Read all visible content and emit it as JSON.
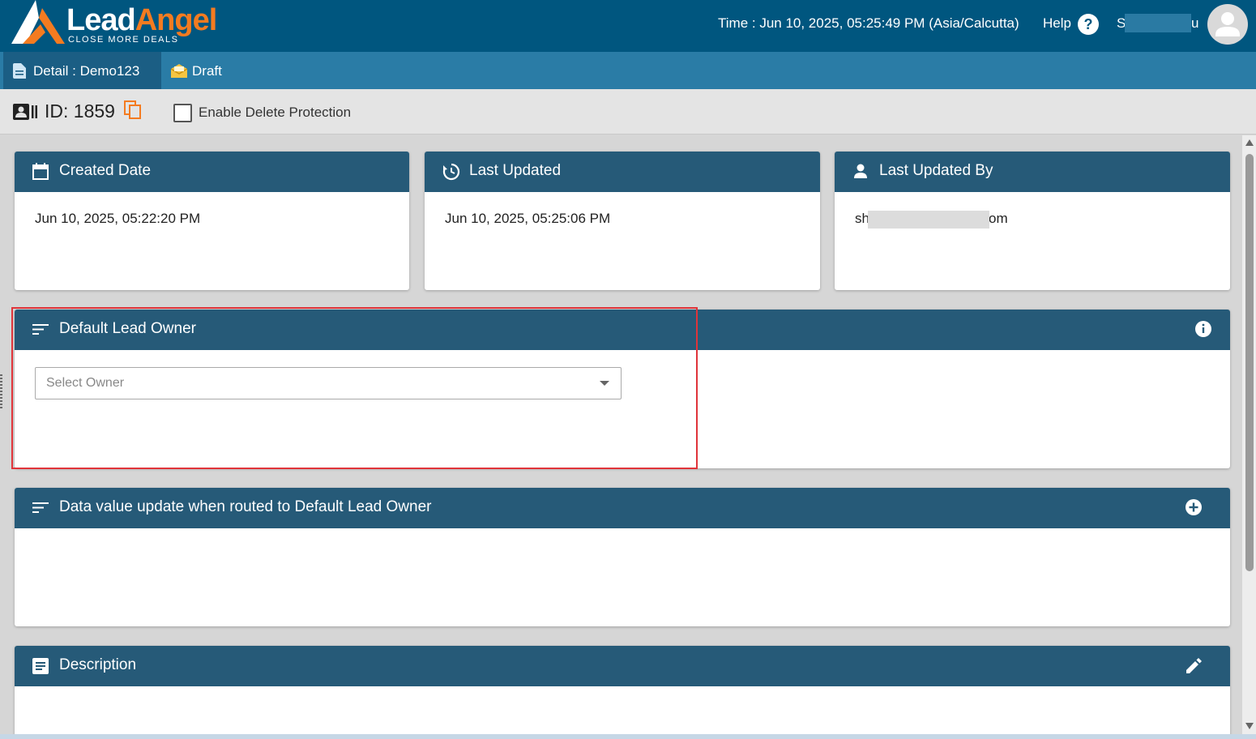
{
  "header": {
    "logo_lead": "Lead",
    "logo_angel": "Angel",
    "logo_tagline": "CLOSE MORE DEALS",
    "time": "Time : Jun 10, 2025, 05:25:49 PM (Asia/Calcutta)",
    "help_label": "Help",
    "help_icon": "?",
    "user_first": "S",
    "user_last": "u"
  },
  "tabs": {
    "detail_label": "Detail : Demo123",
    "draft_label": "Draft"
  },
  "record": {
    "id_label": "ID: 1859",
    "delete_protection_label": "Enable Delete Protection"
  },
  "cards": {
    "created_title": "Created Date",
    "created_value": "Jun 10, 2025, 05:22:20 PM",
    "updated_title": "Last Updated",
    "updated_value": "Jun 10, 2025, 05:25:06 PM",
    "updatedby_title": "Last Updated By",
    "updatedby_prefix": "sh",
    "updatedby_suffix": "om",
    "default_owner_title": "Default Lead Owner",
    "select_placeholder": "Select Owner",
    "data_value_title": "Data value update when routed to Default Lead Owner",
    "description_title": "Description"
  },
  "colors": {
    "topbar": "#00567f",
    "tabbar": "#2a7ca6",
    "card_header": "#265a78",
    "brand_orange": "#f47b20",
    "highlight": "#e0343a"
  }
}
